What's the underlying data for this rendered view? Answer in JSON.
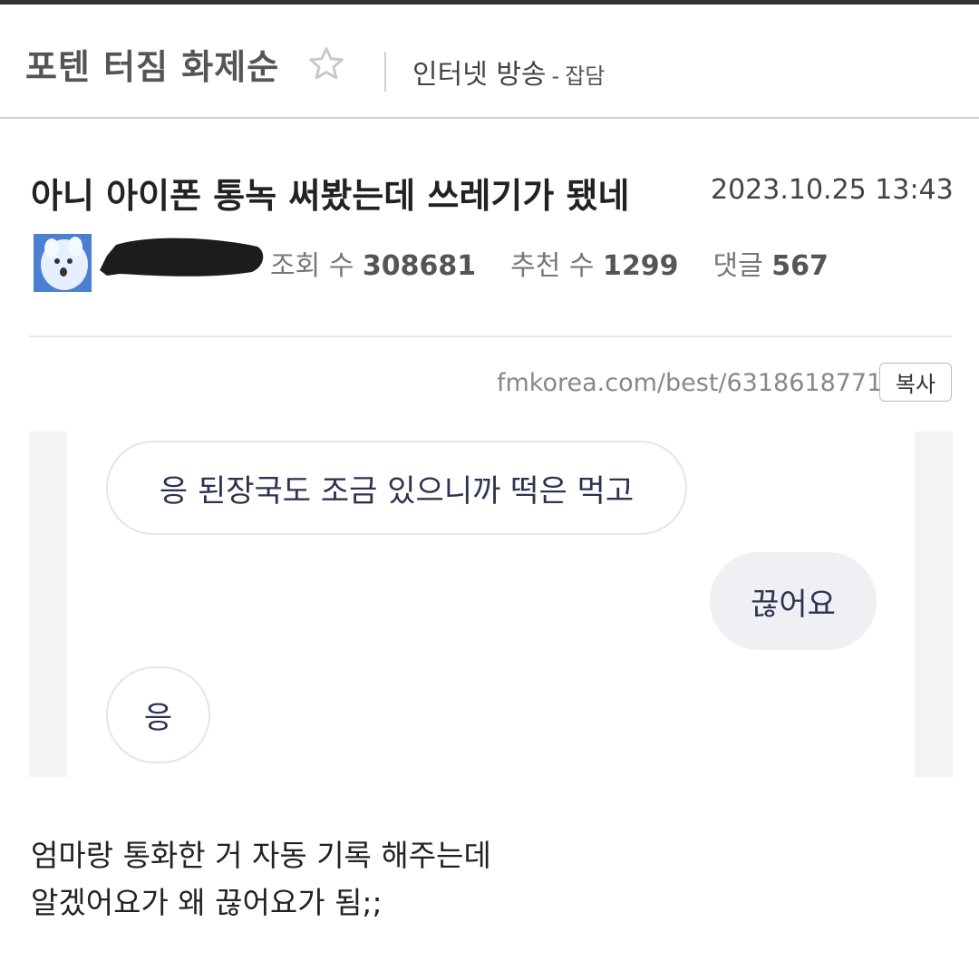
{
  "header": {
    "board_title": "포텐 터짐 화제순",
    "category": "인터넷 방송",
    "category_sep": "-",
    "subcategory": "잡담"
  },
  "post": {
    "title": "아니 아이폰 통녹 써봤는데 쓰레기가 됐네",
    "date": "2023.10.25 13:43",
    "stats": {
      "views_label": "조회 수",
      "views": "308681",
      "likes_label": "추천 수",
      "likes": "1299",
      "comments_label": "댓글",
      "comments": "567"
    },
    "url": "fmkorea.com/best/6318618771",
    "copy_label": "복사",
    "chat": [
      {
        "text": "응 된장국도 조금 있으니까 떡은 먹고",
        "side": "left"
      },
      {
        "text": "끊어요",
        "side": "right"
      },
      {
        "text": "응",
        "side": "left"
      }
    ],
    "body_lines": [
      "엄마랑 통화한 거 자동 기록 해주는데",
      "알겠어요가 왜 끊어요가 됨;;"
    ]
  },
  "icons": {
    "favorite": "star-outline-icon",
    "avatar": "white-dog-avatar"
  }
}
